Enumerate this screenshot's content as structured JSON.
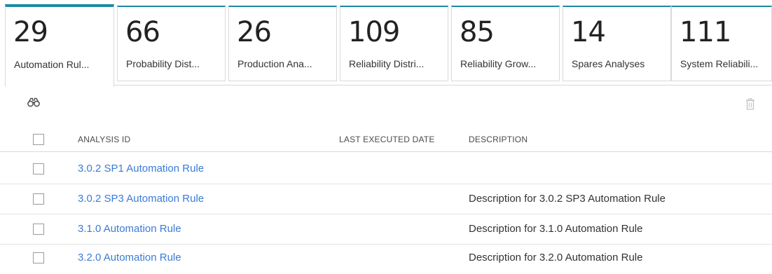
{
  "tabs": [
    {
      "count": "29",
      "label": "Automation Rul...",
      "active": true
    },
    {
      "count": "66",
      "label": "Probability Dist..."
    },
    {
      "count": "26",
      "label": "Production Ana..."
    },
    {
      "count": "109",
      "label": "Reliability Distri..."
    },
    {
      "count": "85",
      "label": "Reliability Grow..."
    },
    {
      "count": "14",
      "label": "Spares Analyses"
    },
    {
      "count": "111",
      "label": "System Reliabili..."
    }
  ],
  "toolbar": {
    "search_icon": "binoculars-icon",
    "delete_icon": "trash-icon"
  },
  "table": {
    "headers": {
      "id": "ANALYSIS ID",
      "date": "LAST EXECUTED DATE",
      "desc": "DESCRIPTION"
    },
    "rows": [
      {
        "id": "3.0.2 SP1 Automation Rule",
        "date": "",
        "desc": ""
      },
      {
        "id": "3.0.2 SP3 Automation Rule",
        "date": "",
        "desc": "Description for 3.0.2 SP3 Automation Rule"
      },
      {
        "id": "3.1.0 Automation Rule",
        "date": "",
        "desc": "Description for 3.1.0 Automation Rule"
      },
      {
        "id": "3.2.0 Automation Rule",
        "date": "",
        "desc": "Description for 3.2.0 Automation Rule"
      }
    ]
  },
  "colors": {
    "accent": "#1c8aa8",
    "link": "#3a7bd5"
  }
}
